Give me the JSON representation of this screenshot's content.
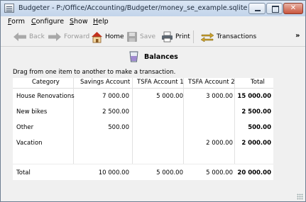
{
  "window": {
    "title": "Budgeter - P:/Office/Accounting/Budgeter/money_se_example.sqlite",
    "close_glyph": "✕"
  },
  "menu": [
    {
      "label": "Form",
      "u": "F",
      "rest": "orm"
    },
    {
      "label": "Configure",
      "u": "C",
      "rest": "onfigure"
    },
    {
      "label": "Show",
      "u": "S",
      "rest": "how"
    },
    {
      "label": "Help",
      "u": "H",
      "rest": "elp"
    }
  ],
  "toolbar": {
    "back": "Back",
    "forward": "Forward",
    "home": "Home",
    "save": "Save",
    "print": "Print",
    "transactions": "Transactions",
    "more": "»"
  },
  "page": {
    "heading": "Balances",
    "instruction": "Drag from one item to another to make a transaction."
  },
  "table": {
    "columns": [
      "Category",
      "Savings Account",
      "TSFA Account 1",
      "TSFA Account 2",
      "Total"
    ],
    "rows": [
      {
        "category": "House Renovations",
        "savings": "7 000.00",
        "tsfa1": "5 000.00",
        "tsfa2": "3 000.00",
        "total": "15 000.00"
      },
      {
        "category": "New bikes",
        "savings": "2 500.00",
        "tsfa1": "",
        "tsfa2": "",
        "total": "2 500.00"
      },
      {
        "category": "Other",
        "savings": "500.00",
        "tsfa1": "",
        "tsfa2": "",
        "total": "500.00"
      },
      {
        "category": "Vacation",
        "savings": "",
        "tsfa1": "",
        "tsfa2": "2 000.00",
        "total": "2 000.00"
      }
    ],
    "total_row": {
      "category": "Total",
      "savings": "10 000.00",
      "tsfa1": "5 000.00",
      "tsfa2": "5 000.00",
      "total": "20 000.00"
    }
  }
}
